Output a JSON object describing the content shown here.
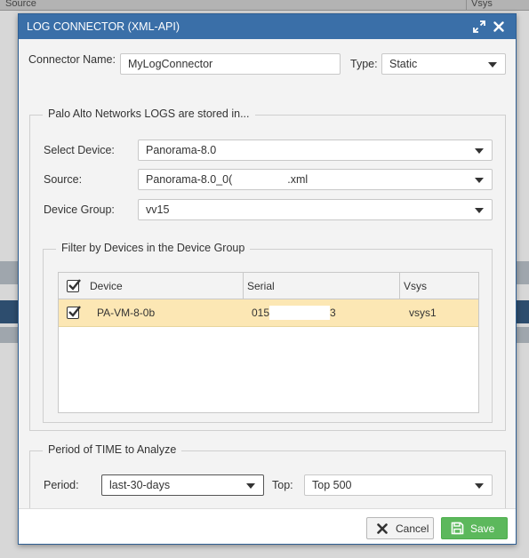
{
  "background": {
    "col_source": "Source",
    "col_vsys": "Vsys"
  },
  "dialog": {
    "title": "LOG CONNECTOR (XML-API)",
    "expand_icon": "expand-arrows-icon",
    "close_icon": "close-x-icon"
  },
  "connector": {
    "name_label": "Connector Name:",
    "name_value": "MyLogConnector",
    "type_label": "Type:",
    "type_value": "Static"
  },
  "logs_section": {
    "legend": "Palo Alto Networks LOGS are stored in...",
    "select_device_label": "Select Device:",
    "select_device_value": "Panorama-8.0",
    "source_label": "Source:",
    "source_value_prefix": "Panorama-8.0_0(",
    "source_value_suffix": ".xml",
    "device_group_label": "Device Group:",
    "device_group_value": "vv15"
  },
  "filter_section": {
    "legend": "Filter by Devices in the Device Group",
    "columns": [
      "Device",
      "Serial",
      "Vsys"
    ],
    "rows": [
      {
        "checked": true,
        "device": "PA-VM-8-0b",
        "serial_prefix": "015",
        "serial_suffix": "3",
        "vsys": "vsys1"
      }
    ]
  },
  "time_section": {
    "legend": "Period of TIME to Analyze",
    "period_label": "Period:",
    "period_value": "last-30-days",
    "top_label": "Top:",
    "top_value": "Top 500"
  },
  "footer": {
    "cancel_label": "Cancel",
    "save_label": "Save"
  },
  "colors": {
    "titlebar": "#3a6fa8",
    "selected_row": "#fce7b4",
    "save_button": "#5cb85c"
  }
}
